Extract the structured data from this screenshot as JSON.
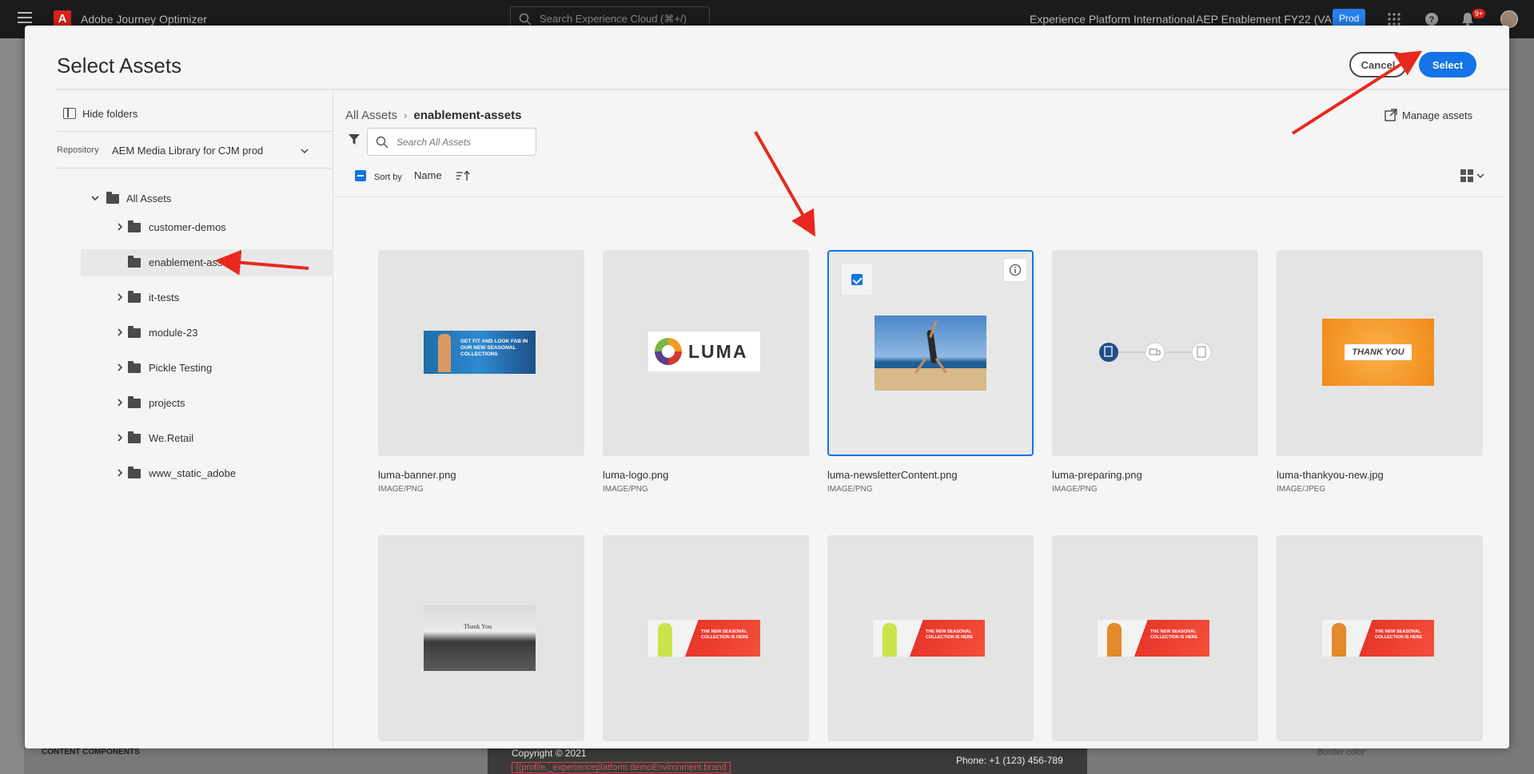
{
  "topbar": {
    "app_name": "Adobe Journey Optimizer",
    "search_placeholder": "Search Experience Cloud (⌘+/)",
    "org": "Experience Platform International",
    "sandbox": "AEP Enablement FY22 (VA7)",
    "env_badge": "Prod",
    "notification_count": "9+",
    "icons": [
      "menu-icon",
      "adobe-logo",
      "search-icon",
      "apps-grid-icon",
      "help-icon",
      "bell-icon",
      "avatar"
    ]
  },
  "background": {
    "footer_copyright": "Copyright © 2021",
    "footer_phone": "Phone: +1 (123) 456-789",
    "footer_profile": "{{profile._experienceplatform.demoEnvironment.brand",
    "content_components": "CONTENT COMPONENTS",
    "border_color": "Border color"
  },
  "dialog": {
    "title": "Select Assets",
    "cancel_label": "Cancel",
    "select_label": "Select",
    "hide_folders_label": "Hide folders",
    "repository_label": "Repository",
    "repository_value": "AEM Media Library for CJM prod",
    "tree": {
      "root": "All Assets",
      "folders": [
        {
          "label": "customer-demos",
          "selected": false
        },
        {
          "label": "enablement-assets",
          "selected": true
        },
        {
          "label": "it-tests",
          "selected": false
        },
        {
          "label": "module-23",
          "selected": false
        },
        {
          "label": "Pickle Testing",
          "selected": false
        },
        {
          "label": "projects",
          "selected": false
        },
        {
          "label": "We.Retail",
          "selected": false
        },
        {
          "label": "www_static_adobe",
          "selected": false
        }
      ]
    },
    "breadcrumb": {
      "root": "All Assets",
      "current": "enablement-assets"
    },
    "manage_assets_label": "Manage assets",
    "search_placeholder": "Search All Assets",
    "sort_by_label": "Sort by",
    "sort_field": "Name",
    "assets": [
      {
        "name": "luma-banner.png",
        "type": "IMAGE/PNG",
        "thumb": "banner-fitness",
        "selected": false
      },
      {
        "name": "luma-logo.png",
        "type": "IMAGE/PNG",
        "thumb": "luma-logo",
        "selected": false
      },
      {
        "name": "luma-newsletterContent.png",
        "type": "IMAGE/PNG",
        "thumb": "yoga-beach",
        "selected": true
      },
      {
        "name": "luma-preparing.png",
        "type": "IMAGE/PNG",
        "thumb": "progress-steps",
        "selected": false
      },
      {
        "name": "luma-thankyou-new.jpg",
        "type": "IMAGE/JPEG",
        "thumb": "thank-you-orange",
        "selected": false
      },
      {
        "name": "",
        "type": "",
        "thumb": "typewriter-thank-you",
        "selected": false
      },
      {
        "name": "",
        "type": "",
        "thumb": "seasonal-banner-yellow",
        "selected": false
      },
      {
        "name": "",
        "type": "",
        "thumb": "seasonal-banner-yellow-2",
        "selected": false
      },
      {
        "name": "",
        "type": "",
        "thumb": "seasonal-banner-orange",
        "selected": false
      },
      {
        "name": "",
        "type": "",
        "thumb": "seasonal-banner-orange-2",
        "selected": false
      }
    ],
    "thumb_text": {
      "banner": "GET FIT AND LOOK FAB IN OUR NEW SEASONAL COLLECTIONS",
      "logo": "LUMA",
      "thankyou": "THANK YOU",
      "typewriter": "Thank You",
      "seasonal": "THE NEW SEASONAL COLLECTION IS HERE"
    }
  },
  "colors": {
    "accent": "#1473e6",
    "annotation": "#e8281e"
  }
}
